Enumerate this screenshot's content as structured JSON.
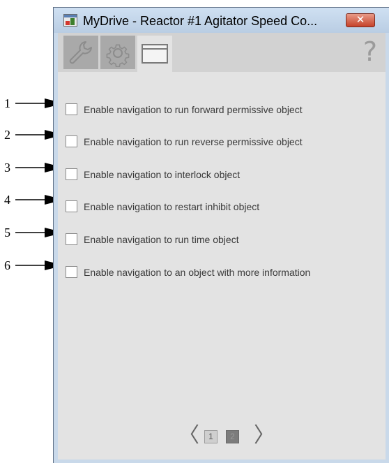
{
  "window": {
    "title": "MyDrive - Reactor #1 Agitator Speed Co...",
    "close_label": "✕"
  },
  "toolbar": {
    "tabs": [
      {
        "name": "wrench-icon",
        "active": false
      },
      {
        "name": "gear-icon",
        "active": false
      },
      {
        "name": "window-icon",
        "active": true
      }
    ],
    "help_label": "?"
  },
  "callouts": [
    "1",
    "2",
    "3",
    "4",
    "5",
    "6"
  ],
  "options": [
    {
      "label": "Enable navigation to run forward permissive object",
      "checked": false
    },
    {
      "label": "Enable navigation to run reverse permissive object",
      "checked": false
    },
    {
      "label": "Enable navigation to interlock object",
      "checked": false
    },
    {
      "label": "Enable navigation to restart inhibit object",
      "checked": false
    },
    {
      "label": "Enable navigation to run time object",
      "checked": false
    },
    {
      "label": "Enable navigation to an object with more information",
      "checked": false
    }
  ],
  "pager": {
    "prev_label": "〈",
    "next_label": "〉",
    "pages": [
      "1",
      "2"
    ],
    "current_page": "2"
  }
}
